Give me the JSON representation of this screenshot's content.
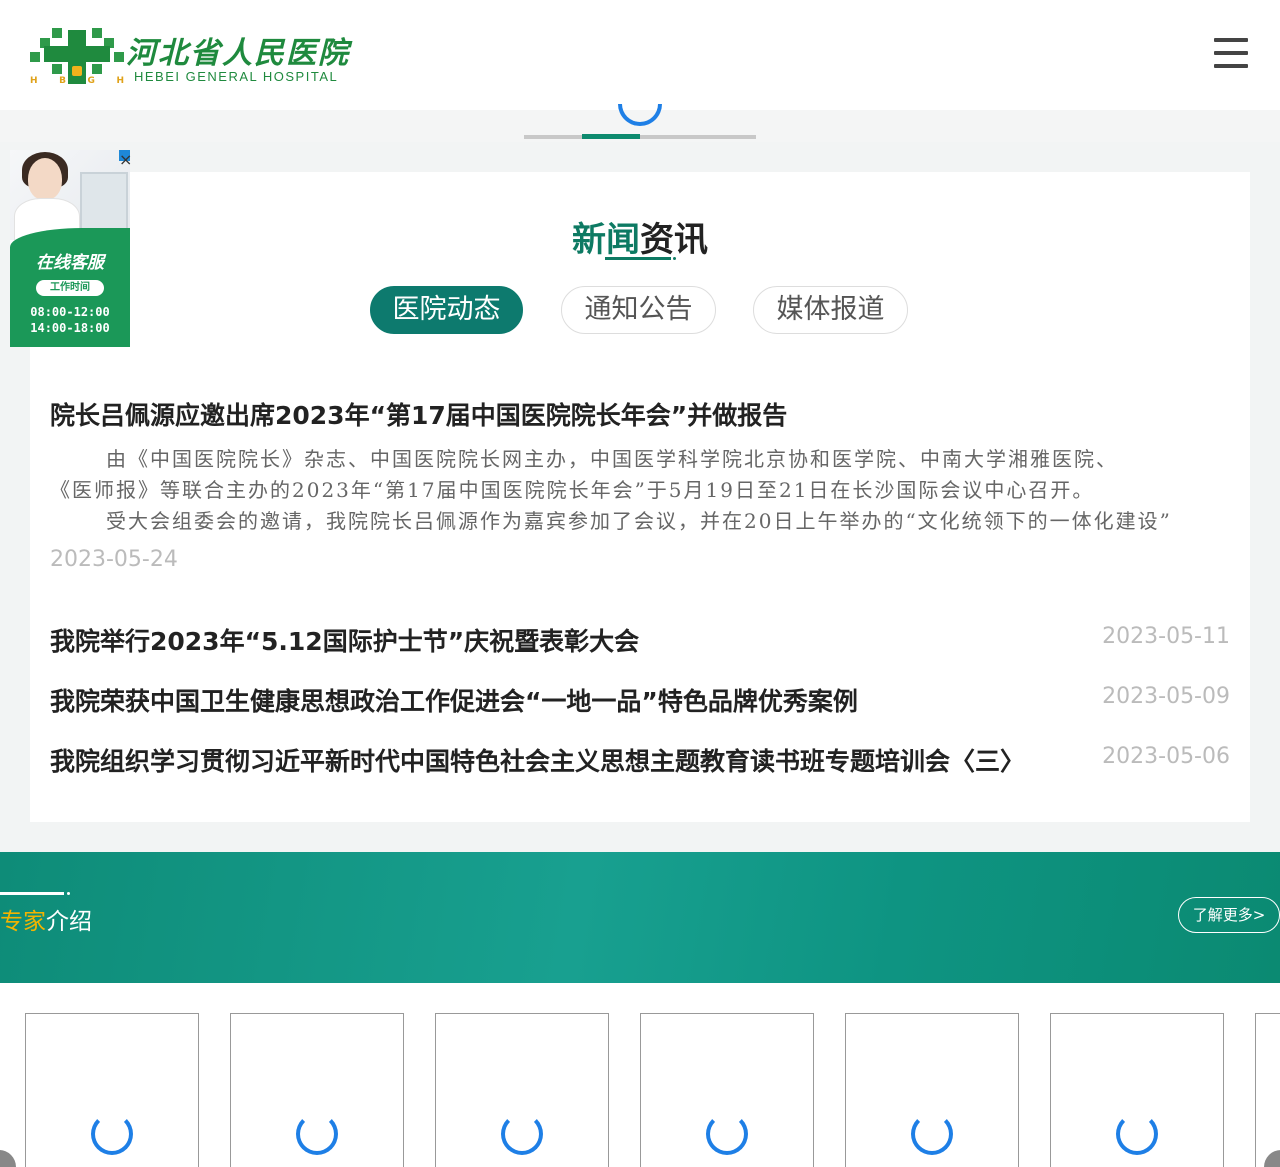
{
  "header": {
    "logo_cn": "河北省人民医院",
    "logo_en": "HEBEI GENERAL HOSPITAL",
    "logo_letters": [
      "H",
      "B",
      "G",
      "H"
    ],
    "menu_icon": "hamburger-menu-icon"
  },
  "slider": {
    "page_count": 4,
    "active_index": 1
  },
  "service_widget": {
    "label": "在线客服",
    "hours_tag": "工作时间",
    "time_1": "08:00-12:00",
    "time_2": "14:00-18:00",
    "close": "×"
  },
  "news": {
    "title_highlight": "新闻",
    "title_rest": "资讯",
    "tabs": [
      {
        "label": "医院动态",
        "active": true
      },
      {
        "label": "通知公告",
        "active": false
      },
      {
        "label": "媒体报道",
        "active": false
      }
    ],
    "featured": {
      "title": "院长吕佩源应邀出席2023年“第17届中国医院院长年会”并做报告",
      "summary_lines": [
        "由《中国医院院长》杂志、中国医院院长网主办，中国医学科学院北京协和医学院、中南大学湘雅医院、",
        "《医师报》等联合主办的2023年“第17届中国医院院长年会”于5月19日至21日在长沙国际会议中心召开。",
        "受大会组委会的邀请，我院院长吕佩源作为嘉宾参加了会议，并在20日上午举办的“文化统领下的一体化建设”"
      ],
      "date": "2023-05-24"
    },
    "items": [
      {
        "title": "我院举行2023年“5.12国际护士节”庆祝暨表彰大会",
        "date": "2023-05-11"
      },
      {
        "title": "我院荣获中国卫生健康思想政治工作促进会“一地一品”特色品牌优秀案例",
        "date": "2023-05-09"
      },
      {
        "title": "我院组织学习贯彻习近平新时代中国特色社会主义思想主题教育读书班专题培训会〈三〉",
        "date": "2023-05-06"
      }
    ]
  },
  "experts": {
    "title_highlight": "专家",
    "title_rest": "介绍",
    "more_label": "了解更多>",
    "card_count": 7
  },
  "colors": {
    "brand_green": "#0d7a63",
    "logo_green": "#1f8a3e",
    "accent_yellow": "#f4b400",
    "spinner_blue": "#1e7fe6"
  }
}
